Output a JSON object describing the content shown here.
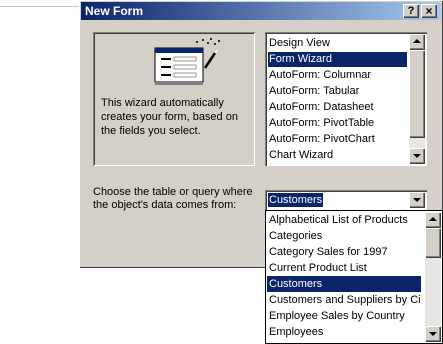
{
  "window": {
    "title": "New Form",
    "help_glyph": "?",
    "close_glyph": "×"
  },
  "preview": {
    "description": "This wizard automatically creates your form, based on the fields you select."
  },
  "form_types": {
    "items": [
      "Design View",
      "Form Wizard",
      "AutoForm:  Columnar",
      "AutoForm:  Tabular",
      "AutoForm:  Datasheet",
      "AutoForm:  PivotTable",
      "AutoForm:  PivotChart",
      "Chart Wizard"
    ],
    "selected": "Form Wizard"
  },
  "source": {
    "label": "Choose the table or query where the object's data comes from:",
    "selected": "Customers",
    "options": [
      "Alphabetical List of Products",
      "Categories",
      "Category Sales for 1997",
      "Current Product List",
      "Customers",
      "Customers and Suppliers by Ci",
      "Employee Sales by Country",
      "Employees"
    ]
  },
  "icons": [
    "wizard-wand-icon",
    "help-icon",
    "close-icon",
    "scroll-up-icon",
    "scroll-down-icon",
    "dropdown-arrow-icon"
  ],
  "colors": {
    "title_start": "#0a246a",
    "title_end": "#a6caf0",
    "selection": "#0a246a",
    "face": "#d4d0c8"
  }
}
